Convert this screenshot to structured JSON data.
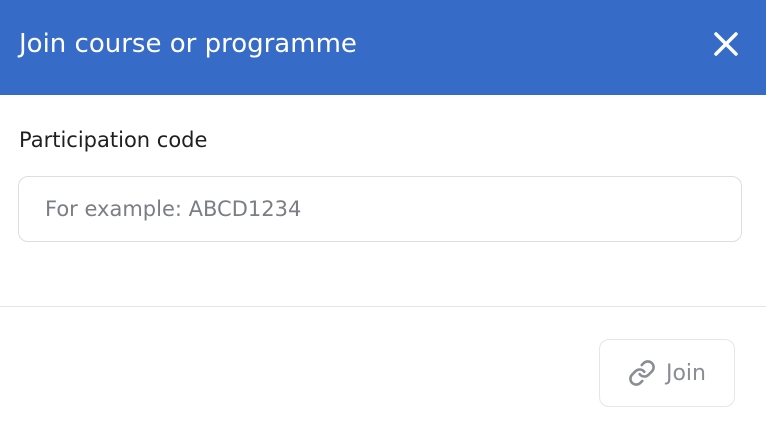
{
  "dialog": {
    "title": "Join course or programme",
    "close_icon": "close-icon",
    "field_label": "Participation code",
    "input": {
      "value": "",
      "placeholder": "For example: ABCD1234"
    },
    "join_button": {
      "label": "Join",
      "icon": "link-icon",
      "state": "disabled"
    }
  },
  "colors": {
    "header_bg": "#366bc8",
    "header_text": "#ffffff",
    "button_text_disabled": "#8a8d92",
    "border": "#dcdee2"
  }
}
